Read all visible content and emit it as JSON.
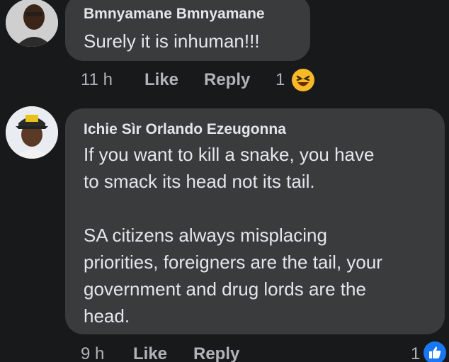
{
  "comments": [
    {
      "author": "Bmnyamane Bmnyamane",
      "text": "Surely it is inhuman!!!",
      "time": "11 h",
      "like_label": "Like",
      "reply_label": "Reply",
      "reaction_count": "1",
      "reaction_icon": "haha-emoji-icon"
    },
    {
      "author": "Ichie Sìr Orlando Ezeugonna",
      "text_lines": [
        "If you want to kill a snake, you have",
        "to smack its head not its tail.",
        "",
        "SA citizens always misplacing",
        "priorities, foreigners are the tail, your",
        "government and drug lords are the",
        "head."
      ],
      "time": "9 h",
      "like_label": "Like",
      "reply_label": "Reply",
      "reaction_count": "1",
      "reaction_icon": "like-thumb-icon"
    }
  ],
  "colors": {
    "background": "#18191a",
    "bubble": "#3a3b3c",
    "text": "#e4e6eb",
    "meta": "#b0b3b8",
    "like_blue": "#1877f2",
    "haha_yellow": "#f7b928"
  }
}
